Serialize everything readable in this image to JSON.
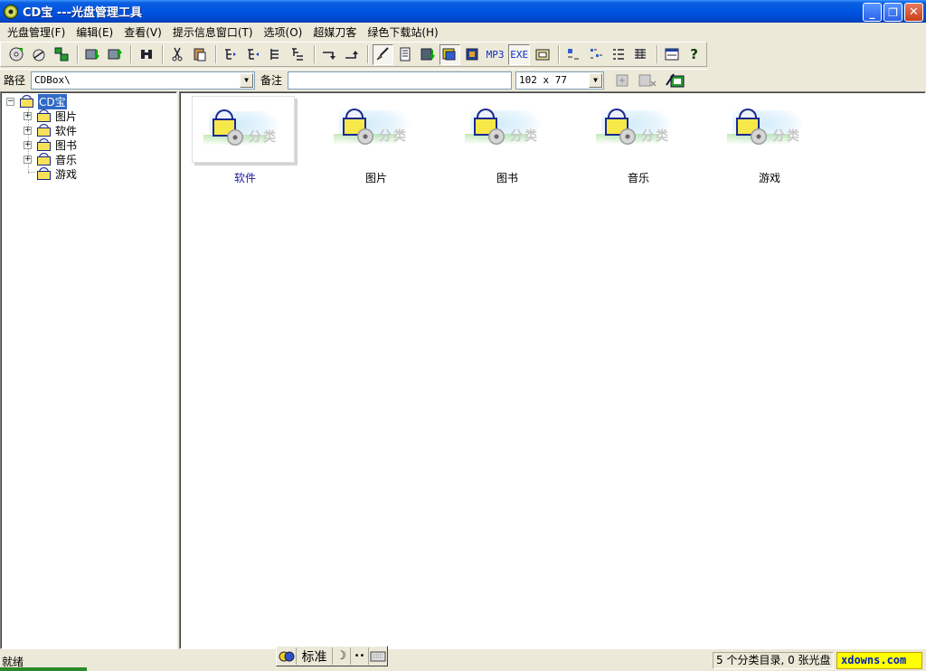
{
  "window": {
    "title": "CD宝 ---光盘管理工具",
    "buttons": {
      "minimize": "_",
      "restore": "❐",
      "close": "✕"
    }
  },
  "menu": [
    "光盘管理(F)",
    "编辑(E)",
    "查看(V)",
    "提示信息窗口(T)",
    "选项(O)",
    "超媒刀客",
    "绿色下载站(H)"
  ],
  "toolbar": {
    "mp3_label": "MP3",
    "exe_label": "EXE",
    "help_label": "?"
  },
  "pathbar": {
    "path_label": "路径",
    "path_value": "CDBox\\",
    "note_label": "备注",
    "note_value": "",
    "size_value": "102 x 77"
  },
  "tree": {
    "root": "CD宝",
    "items": [
      "图片",
      "软件",
      "图书",
      "音乐",
      "游戏"
    ]
  },
  "content": {
    "tiles": [
      {
        "label": "软件",
        "selected": true
      },
      {
        "label": "图片",
        "selected": false
      },
      {
        "label": "图书",
        "selected": false
      },
      {
        "label": "音乐",
        "selected": false
      },
      {
        "label": "游戏",
        "selected": false
      }
    ],
    "thumb_caption": "分类"
  },
  "ime": {
    "mode": "标准"
  },
  "status": {
    "left": "就绪",
    "count": "5 个分类目录, 0 张光盘",
    "brand": "xdowns.com"
  },
  "colors": {
    "title_bar": "#0054e3",
    "selection": "#316ac5",
    "brand_bg": "#ffff00"
  }
}
